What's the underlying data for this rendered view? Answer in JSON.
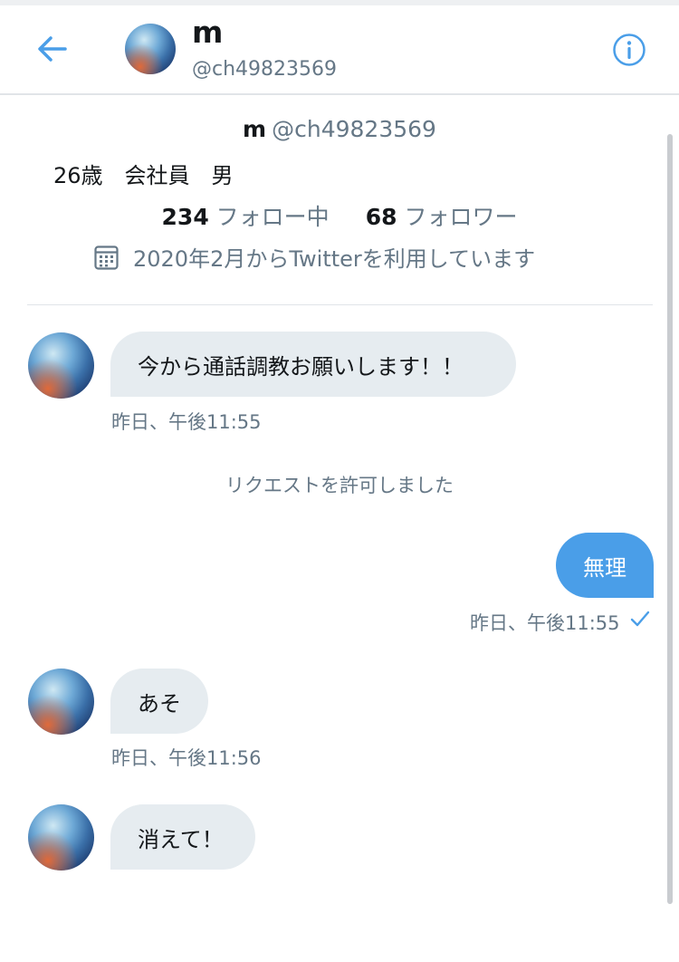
{
  "header": {
    "name": "m",
    "handle": "@ch49823569"
  },
  "profile": {
    "name": "m",
    "handle": "@ch49823569",
    "bio": "26歳　会社員　男",
    "following_count": "234",
    "following_label": "フォロー中",
    "followers_count": "68",
    "followers_label": "フォロワー",
    "joined": "2020年2月からTwitterを利用しています"
  },
  "messages": [
    {
      "text": "今から通話調教お願いします！！",
      "time": "昨日、午後11:55"
    },
    {
      "system": "リクエストを許可しました"
    },
    {
      "text": "無理",
      "time": "昨日、午後11:55"
    },
    {
      "text": "あそ",
      "time": "昨日、午後11:56"
    },
    {
      "text": "消えて！"
    }
  ],
  "colors": {
    "accent": "#4a9ee8",
    "incoming_bubble": "#e6ecf0",
    "secondary_text": "#657786"
  },
  "icons": [
    "back-arrow-icon",
    "info-icon",
    "calendar-icon",
    "sent-check-icon"
  ]
}
